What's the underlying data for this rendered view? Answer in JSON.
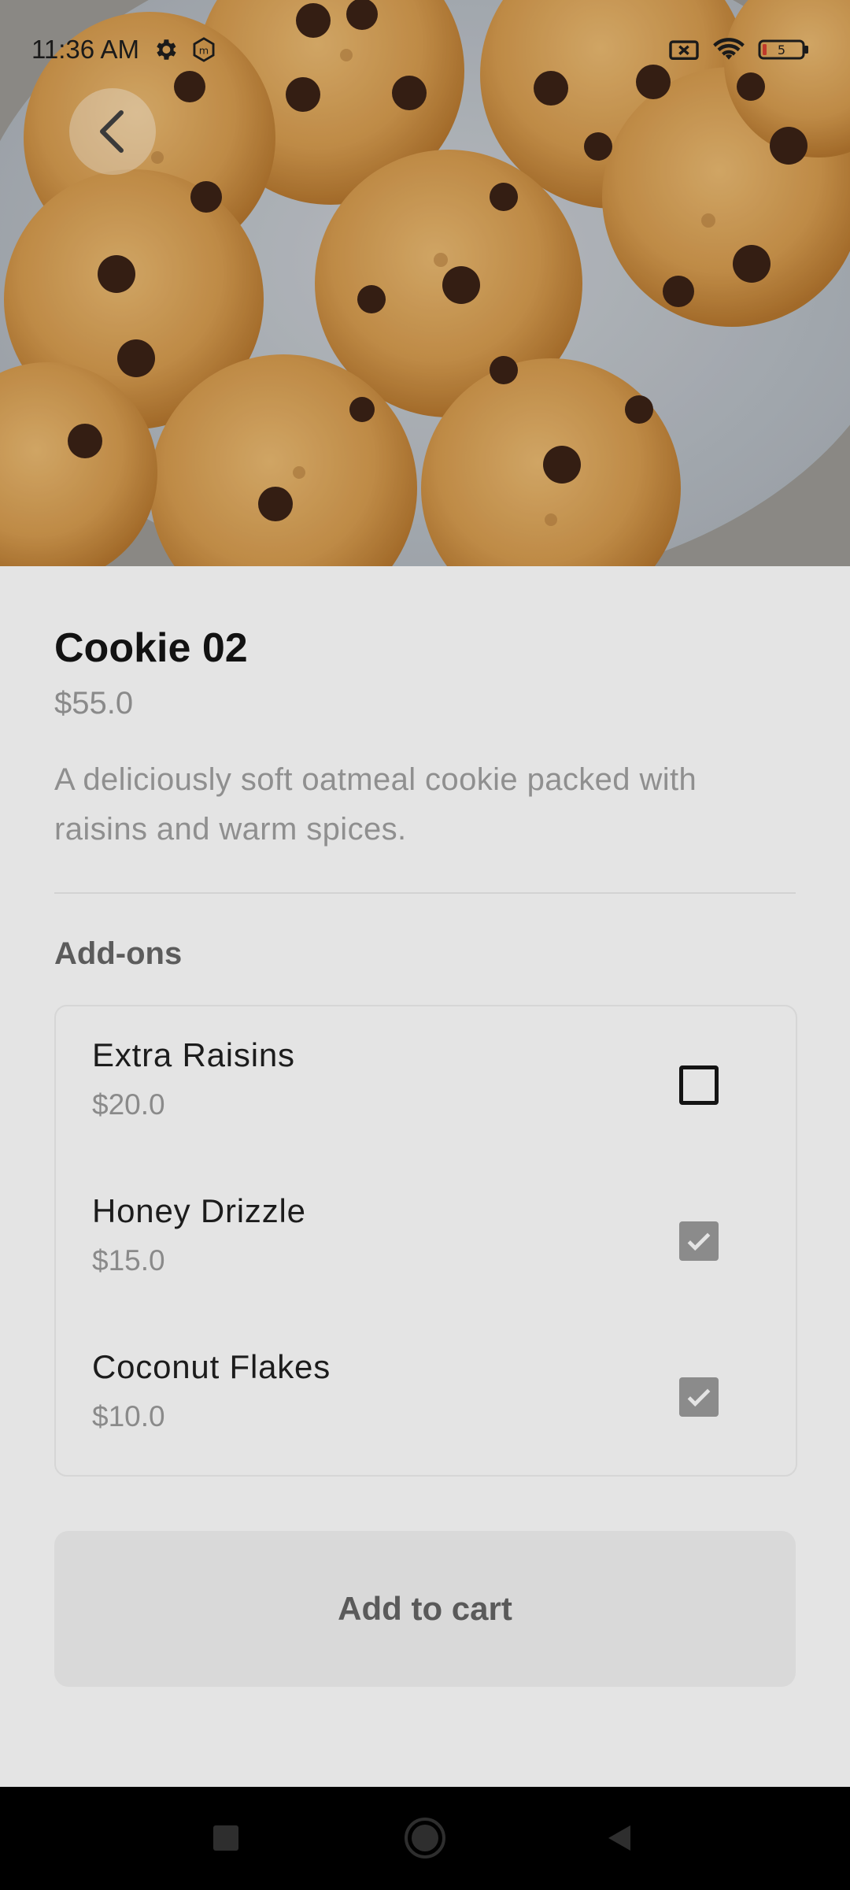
{
  "status_bar": {
    "time": "11:36 AM",
    "icons": [
      "settings-icon",
      "app-badge-icon",
      "no-sim-icon",
      "wifi-icon",
      "battery-icon"
    ],
    "battery_level": "5"
  },
  "hero": {
    "image": "chocolate-chip-cookies-on-plate"
  },
  "product": {
    "title": "Cookie 02",
    "price": "$55.0",
    "description": "A deliciously soft oatmeal cookie packed with raisins and warm spices."
  },
  "addons": {
    "heading": "Add-ons",
    "items": [
      {
        "name": "Extra Raisins",
        "price": "$20.0",
        "checked": false
      },
      {
        "name": "Honey Drizzle",
        "price": "$15.0",
        "checked": true
      },
      {
        "name": "Coconut Flakes",
        "price": "$10.0",
        "checked": true
      }
    ]
  },
  "cta": {
    "label": "Add to cart"
  },
  "nav": {
    "icons": [
      "recents-square-icon",
      "home-circle-icon",
      "back-triangle-icon"
    ]
  },
  "colors": {
    "background": "#e4e4e4",
    "checkbox_checked": "#8b8b8b",
    "button_bg": "#d9d9d9",
    "nav_bar": "#000000"
  }
}
